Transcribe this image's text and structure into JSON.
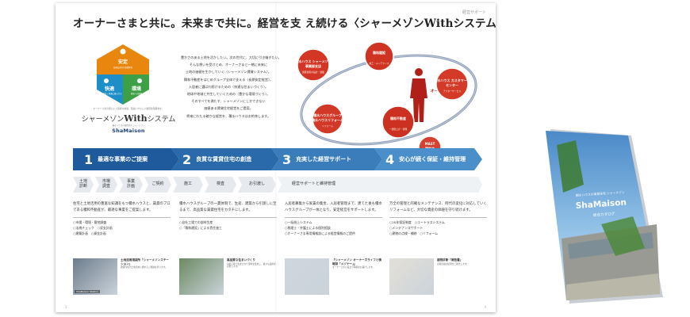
{
  "section_tag": "経営サポート",
  "headline": "オーナーさまと共に。未来まで共に。経営を支 え続ける〈シャーメゾンWithシステム〉。",
  "hexagon": {
    "segments": [
      {
        "label": "安定",
        "sub": "長期安定的な事業経営",
        "color": "#e8860e"
      },
      {
        "label": "快適",
        "sub": "入居者が長く快適に暮らせる",
        "color": "#1e8ec8"
      },
      {
        "label": "環境",
        "sub": "環境への配慮",
        "color": "#3ea046"
      }
    ],
    "caption": "オーナーさまの安心と入居者の快適、環境にやさしい賃貸住宅経営を。",
    "name_prefix": "シャーメゾン",
    "name_with": "With",
    "name_suffix": "システム",
    "sub": "積水ハウスの賃貸住宅 シャーメゾン",
    "logo": "ShaMaison"
  },
  "intro_lines": [
    "豊かさのある土地を活かしたい。次の世代に、大切に引き継ぎたい。",
    "そんな想いを受けとめ、オーナーさまと一緒に未来に",
    "土地の価値を生かしていく〈シャーメゾン賃貸システム〉。",
    "積和不動産をはじめグループ全体で支える〈長期安定経営〉。",
    "入居者に選ばれ続けるための〈快適な住まいづくり〉。",
    "地球や地域と共生していくための〈豊かな環境づくり〉。",
    "そのすべてを満たす、シャーメゾンにしかできない",
    "価値ある賃貸住宅経営をご提案。",
    "将来にわたる確かな経営を、積水ハウスはお約束します。"
  ],
  "orbit": {
    "owner_label": "オーナーさま",
    "nodes": [
      {
        "title": "積水ハウス シャーメゾン",
        "sub": "事業部支店",
        "title2": "",
        "note": "賃貸住宅の設計・建築",
        "color": "#d43626"
      },
      {
        "title": "積和建設",
        "sub": "",
        "title2": "",
        "note": "施工・メンテナンス",
        "color": "#cf3422"
      },
      {
        "title": "積水ハウス カスタマーズ",
        "sub": "センター",
        "title2": "",
        "note": "アフターサービス",
        "color": "#d43a28"
      },
      {
        "title": "MAST",
        "sub": "積和会",
        "title2": "",
        "note": "",
        "color": "#d64030"
      },
      {
        "title": "積和不動産",
        "sub": "",
        "title2": "",
        "note": "一括借上げ・管理",
        "color": "#cc3020"
      },
      {
        "title": "積水ハウスグループ",
        "sub": "積水ハウスリフォーム",
        "title2": "",
        "note": "リフォーム",
        "color": "#d23828"
      }
    ]
  },
  "steps": [
    {
      "num": "1",
      "label": "最適な事業のご提案",
      "color": "#1f5a9c"
    },
    {
      "num": "2",
      "label": "良質な賃貸住宅の創造",
      "color": "#2a6aaa"
    },
    {
      "num": "3",
      "label": "充実した経営サポート",
      "color": "#3a7dba"
    },
    {
      "num": "4",
      "label": "安心が続く保証・維持管理",
      "color": "#4a8fca"
    }
  ],
  "process_tags": [
    {
      "label": "土地\n診断"
    },
    {
      "label": "市場\n調査"
    },
    {
      "label": "事業\n計画"
    },
    {
      "label": "ご契約"
    },
    {
      "label": "施工"
    },
    {
      "label": "検査"
    },
    {
      "label": "お引渡し"
    },
    {
      "label": "経営サポートと維持管理"
    }
  ],
  "columns": [
    {
      "body": "住宅と土地活用の豊富な知識をもつ積水ハウスと、賃貸のプロである積和不動産が、最適な事業をご提案します。",
      "bullets": [
        "○市場・環境・敷地調査",
        "○法規チェック　○収支計画",
        "○建築計画　○資金計画"
      ],
      "photo_label": "ShaMaison Station",
      "caption_title": "土地活用相談所「シャーメゾンステーション」",
      "caption_body": "賃貸住宅や土地活用に関するご相談を承ります。"
    },
    {
      "body": "積水ハウスグループの一貫体制で、生産、建築から引渡しに至るまで、高品質な賃貸住宅をカタチにします。",
      "bullets": [
        "○自社工場での部材生産",
        "○「積和建設」による責任施工"
      ],
      "photo_label": "",
      "caption_title": "高品質な住まいづくり",
      "caption_body": "自社工場で生産された部材を使用し、確かな品質を実現します。"
    },
    {
      "body": "入居者募集から家賃の集金、入居者管理まで、建てた後も積水ハウスグループが一体となり、安定経営をサポートします。",
      "bullets": [
        "○一括借上システム",
        "○税理士・弁護士による個別相談",
        "○オーナーさま専用情報誌による経営情報のご提供"
      ],
      "photo_label": "",
      "caption_title": "『シャーメゾン オーナーズライフと情報誌「メゾナー」』",
      "caption_body": "オーナーさまに役立つ情報をお届けします。"
    },
    {
      "body": "万全の管理と的確なメンテナンス、時代の変化に対応していくリフォームなど、大切な資産の価値を守り続けます。",
      "bullets": [
        "○20年保証制度　○ユートラスシステム",
        "○メンテナンスサポート",
        "○建物の点検・補修　○リフォーム"
      ],
      "photo_label": "",
      "caption_title": "建物診断「報告書」",
      "caption_body": "定期点検の結果をご報告します。"
    }
  ],
  "page_numbers": [
    "3",
    "4"
  ],
  "cover": {
    "subtitle": "積水ハウスの賃貸住宅 シャーメゾン",
    "logo": "ShaMaison",
    "catalog": "総合カタログ"
  }
}
